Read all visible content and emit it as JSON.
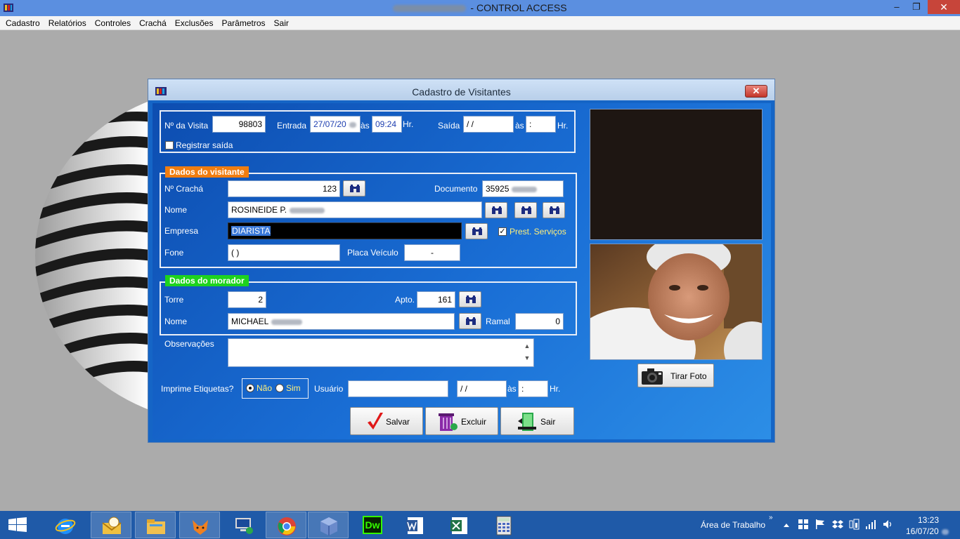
{
  "app": {
    "title": "- CONTROL ACCESS",
    "controls": {
      "minimize": "–",
      "maximize": "❐",
      "close": "✕"
    }
  },
  "menu": [
    "Cadastro",
    "Relatórios",
    "Controles",
    "Crachá",
    "Exclusões",
    "Parâmetros",
    "Sair"
  ],
  "dialog": {
    "title": "Cadastro de Visitantes",
    "close": "✕",
    "visit": {
      "numero_label": "Nº da Visita",
      "numero_value": "98803",
      "entrada_label": "Entrada",
      "entrada_date": "27/07/20",
      "as_label": "às",
      "entrada_time": "09:24",
      "hr_label": "Hr.",
      "saida_label": "Saída",
      "saida_date": " / /",
      "saida_as_label": "às",
      "saida_time": " :",
      "saida_hr_label": "Hr.",
      "registrar_label": "Registrar saída",
      "registrar_checked": false
    },
    "visitante": {
      "legend": "Dados do visitante",
      "legend_color": "#f07d10",
      "cracha_label": "Nº Crachá",
      "cracha_value": "123",
      "documento_label": "Documento",
      "documento_value": "35925",
      "nome_label": "Nome",
      "nome_value": "ROSINEIDE P.",
      "empresa_label": "Empresa",
      "empresa_value": "DIARISTA",
      "prest_label": "Prest. Serviços",
      "prest_checked": true,
      "fone_label": "Fone",
      "fone_value": "( )",
      "placa_label": "Placa Veículo",
      "placa_value": "-"
    },
    "morador": {
      "legend": "Dados do morador",
      "legend_color": "#1ed31e",
      "torre_label": "Torre",
      "torre_value": "2",
      "apto_label": "Apto.",
      "apto_value": "161",
      "nome_label": "Nome",
      "nome_value": "MICHAEL",
      "ramal_label": "Ramal",
      "ramal_value": "0"
    },
    "observacoes_label": "Observações",
    "observacoes_value": "",
    "etiquetas": {
      "label": "Imprime Etiquetas?",
      "nao": "Não",
      "sim": "Sim",
      "selected": "Não"
    },
    "usuario_label": "Usuário",
    "usuario_value": "",
    "footer_date": " / /",
    "footer_as": "às",
    "footer_time": " :",
    "footer_hr": "Hr.",
    "tirar_foto": "Tirar Foto",
    "buttons": {
      "salvar": "Salvar",
      "excluir": "Excluir",
      "sair": "Sair"
    }
  },
  "taskbar": {
    "apps": [
      "internet-explorer-icon",
      "outlook-icon",
      "file-explorer-icon",
      "fox-app-icon",
      "remote-desktop-icon",
      "chrome-icon",
      "virtualbox-icon",
      "dreamweaver-icon",
      "word-icon",
      "excel-icon",
      "calculator-icon"
    ],
    "dreamweaver_text": "Dw",
    "area_label": "Área de Trabalho",
    "time": "13:23",
    "date": "16/07/20"
  }
}
